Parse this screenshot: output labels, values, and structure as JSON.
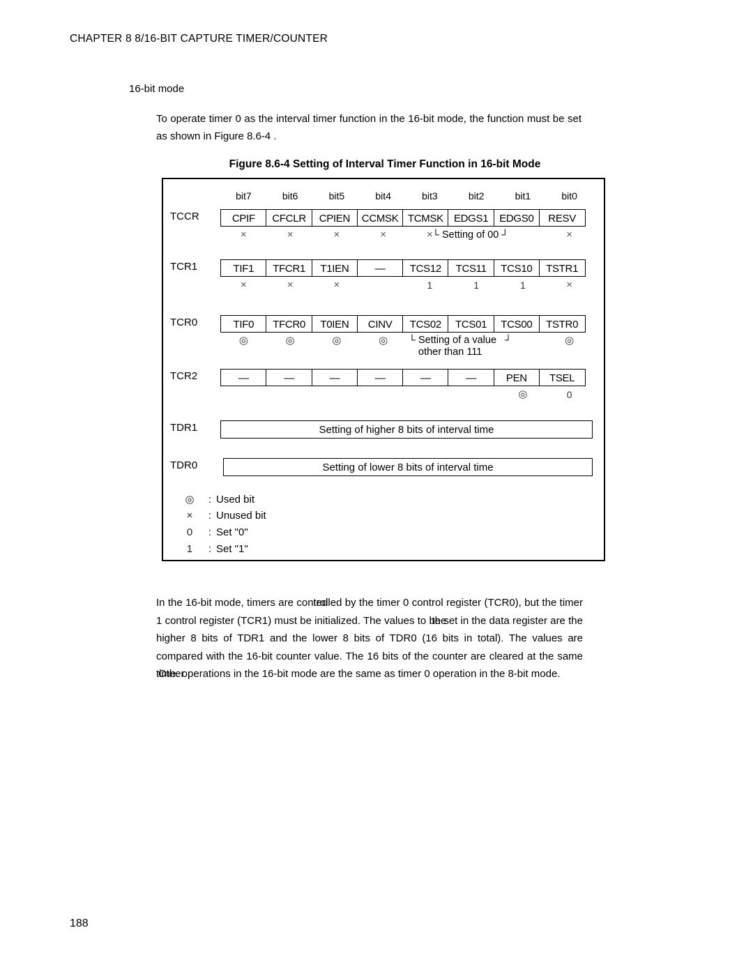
{
  "header": {
    "chapter": "CHAPTER 8  8/16-BIT CAPTURE TIMER/COUNTER"
  },
  "section": {
    "title": "16-bit mode"
  },
  "intro": {
    "text": "To operate timer 0 as the interval timer function in the 16-bit mode, the function must be set as shown in Figure 8.6-4 ."
  },
  "figure": {
    "caption": "Figure 8.6-4  Setting of Interval Timer Function in 16-bit Mode",
    "bit_headers": [
      "bit7",
      "bit6",
      "bit5",
      "bit4",
      "bit3",
      "bit2",
      "bit1",
      "bit0"
    ],
    "registers": [
      {
        "name": "TCCR",
        "cells": [
          "CPIF",
          "CFCLR",
          "CPIEN",
          "CCMSK",
          "TCMSK",
          "EDGS1",
          "EDGS0",
          "RESV"
        ],
        "marks": [
          "×",
          "×",
          "×",
          "×",
          "×",
          "",
          "",
          "×"
        ],
        "annotation": "Setting of 00"
      },
      {
        "name": "TCR1",
        "cells": [
          "TIF1",
          "TFCR1",
          "T1IEN",
          "—",
          "TCS12",
          "TCS11",
          "TCS10",
          "TSTR1"
        ],
        "marks": [
          "×",
          "×",
          "×",
          "",
          "1",
          "1",
          "1",
          "×"
        ],
        "annotation": ""
      },
      {
        "name": "TCR0",
        "cells": [
          "TIF0",
          "TFCR0",
          "T0IEN",
          "CINV",
          "TCS02",
          "TCS01",
          "TCS00",
          "TSTR0"
        ],
        "marks": [
          "◎",
          "◎",
          "◎",
          "◎",
          "",
          "",
          "",
          "◎"
        ],
        "annotation_line1": "Setting of a value",
        "annotation_line2": "other than 111"
      },
      {
        "name": "TCR2",
        "cells": [
          "—",
          "—",
          "—",
          "—",
          "—",
          "—",
          "PEN",
          "TSEL"
        ],
        "marks": [
          "",
          "",
          "",
          "",
          "",
          "",
          "◎",
          "0"
        ],
        "annotation": ""
      }
    ],
    "data_registers": [
      {
        "name": "TDR1",
        "text": "Setting of higher 8 bits of interval time"
      },
      {
        "name": "TDR0",
        "text": "Setting of lower 8 bits of interval time"
      }
    ],
    "legend": [
      {
        "symbol": "◎",
        "colon": ":",
        "text": "Used bit"
      },
      {
        "symbol": "×",
        "colon": ":",
        "text": "Unused bit"
      },
      {
        "symbol": "0",
        "colon": ":",
        "text": "Set \"0\""
      },
      {
        "symbol": "1",
        "colon": ":",
        "text": "Set \"1\""
      }
    ],
    "bracket_left": "└",
    "bracket_right": "┘"
  },
  "closing": {
    "seg1": "In the 16-bit mode, timers are ",
    "glitch1_a": "controlled",
    "glitch1_b": "ted",
    "seg2": " by the timer 0 control register (TCR0), but the timer 1 control register (TCR1) must be initialized. The values to ",
    "glitch2_a": "be set in",
    "glitch2_b": "the",
    "seg3": " the data register are the higher 8 bits of TDR1 and the lower 8 bits of TDR0 (16 bits in total). The values are compared with the 16-bit counter value. The 16 bits of the counter are cleared at the same ",
    "glitch3_a": "time.",
    "glitch3_b": "Other",
    "seg4": " operations in the 16-bit mode are the same as timer 0 operation in the 8-bit mode."
  },
  "footer": {
    "page_number": "188"
  }
}
